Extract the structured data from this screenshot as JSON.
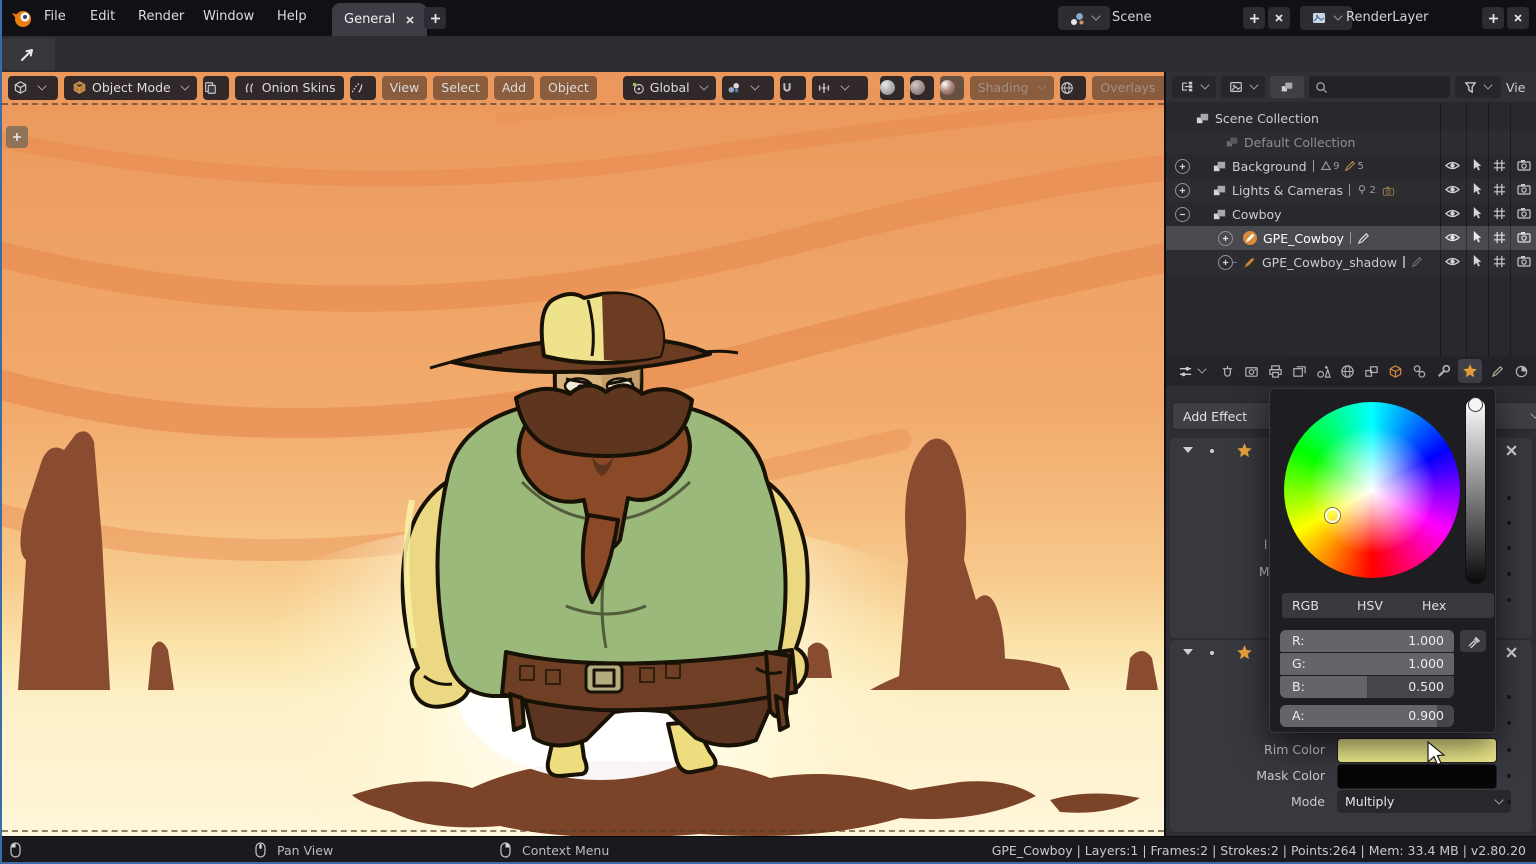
{
  "topbar": {
    "menus": [
      "File",
      "Edit",
      "Render",
      "Window",
      "Help"
    ],
    "workspace_tab": "General",
    "scene": {
      "label": "Scene"
    },
    "render_layer": {
      "label": "RenderLayer"
    }
  },
  "viewport_header": {
    "mode": "Object Mode",
    "onion_skins": "Onion Skins",
    "menus": [
      "View",
      "Select",
      "Add",
      "Object"
    ],
    "orientation": "Global",
    "shading": "Shading",
    "overlays": "Overlays"
  },
  "outliner": {
    "view_menu": "Vie",
    "rows": [
      {
        "label": "Scene Collection"
      },
      {
        "label": "Default Collection"
      },
      {
        "label": "Background",
        "badge_mesh": "9",
        "badge_pencil": "5"
      },
      {
        "label": "Lights & Cameras",
        "badge_light": "2"
      },
      {
        "label": "Cowboy"
      },
      {
        "label": "GPE_Cowboy"
      },
      {
        "label": "GPE_Cowboy_shadow"
      }
    ]
  },
  "properties": {
    "add_effect": "Add Effect",
    "rim_color_label": "Rim Color",
    "mask_color_label": "Mask Color",
    "mode_label": "Mode",
    "mode_value": "Multiply",
    "rim_color_hex": "#f1ee8e",
    "mask_color_hex": "#060606",
    "covered_label_fragment_1": "l",
    "covered_label_fragment_2": "M"
  },
  "color_picker": {
    "tabs": [
      "RGB",
      "HSV",
      "Hex"
    ],
    "channels": [
      {
        "label": "R:",
        "value": "1.000",
        "fill": 1
      },
      {
        "label": "G:",
        "value": "1.000",
        "fill": 1
      },
      {
        "label": "B:",
        "value": "0.500",
        "fill": 0.5
      },
      {
        "label": "A:",
        "value": "0.900",
        "fill": 0.9
      }
    ]
  },
  "status_bar": {
    "pan_view": "Pan View",
    "context_menu": "Context Menu",
    "stats": "GPE_Cowboy | Layers:1 | Frames:2 | Strokes:2 | Points:264 | Mem: 33.4 MB | v2.80.20"
  },
  "scene_colors": {
    "sky_top": "#ec9a5e",
    "sky_mid": "#f5b878",
    "horizon": "#fbe9b2",
    "ground": "#fdf4d6",
    "streak": "#e78e55",
    "rock": "#8a4c30",
    "shadow": "#7b4327",
    "shirt": "#9cb97c",
    "skin": "#d9b37c",
    "hat": "#efe28c",
    "bandana": "#8a4a28",
    "arm": "#ecd783"
  }
}
